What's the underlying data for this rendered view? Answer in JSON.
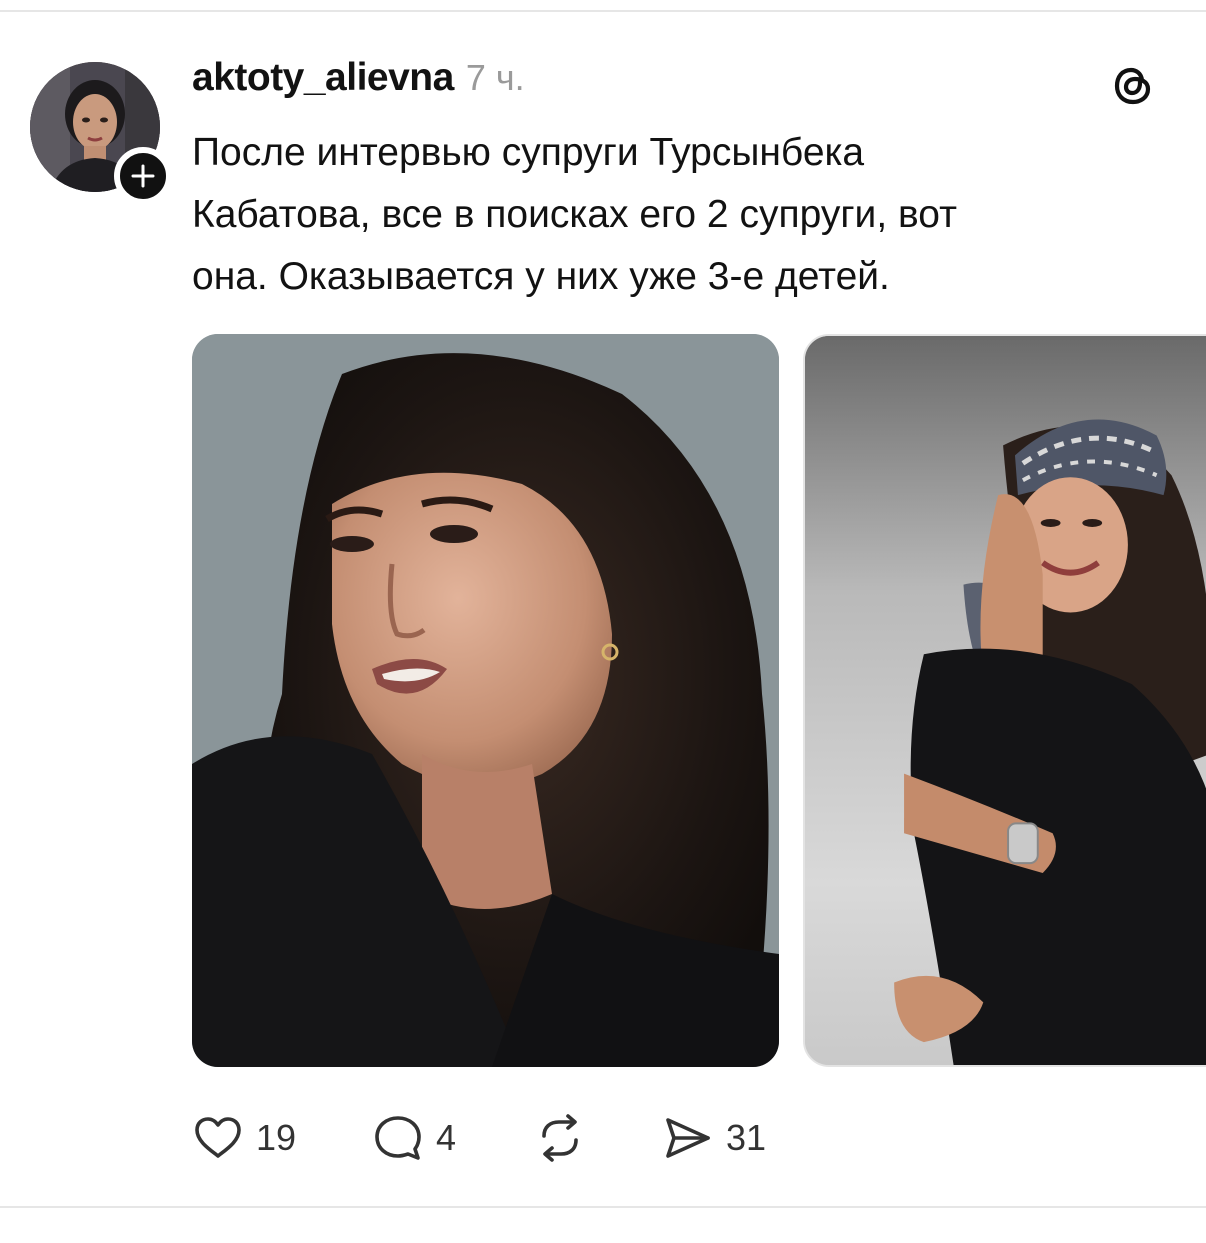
{
  "post": {
    "username": "aktoty_alievna",
    "time": "7 ч.",
    "text_lines": [
      "После интервью супруги Турсынбека",
      "Кабатова, все в поисках его 2 супруги, вот",
      "она. Оказывается у них уже 3-е детей."
    ]
  },
  "images": [
    {
      "description_icon": "portrait-photo"
    },
    {
      "description_icon": "portrait-photo"
    }
  ],
  "actions": {
    "likes": "19",
    "replies": "4",
    "shares": "31"
  },
  "icons": {
    "follow": "plus-icon",
    "brand": "threads-logo-icon",
    "like": "heart-icon",
    "reply": "comment-icon",
    "repost": "repost-icon",
    "share": "send-icon"
  },
  "colors": {
    "text": "#121212",
    "muted": "#9a9a9a",
    "divider": "#e6e6e6"
  }
}
